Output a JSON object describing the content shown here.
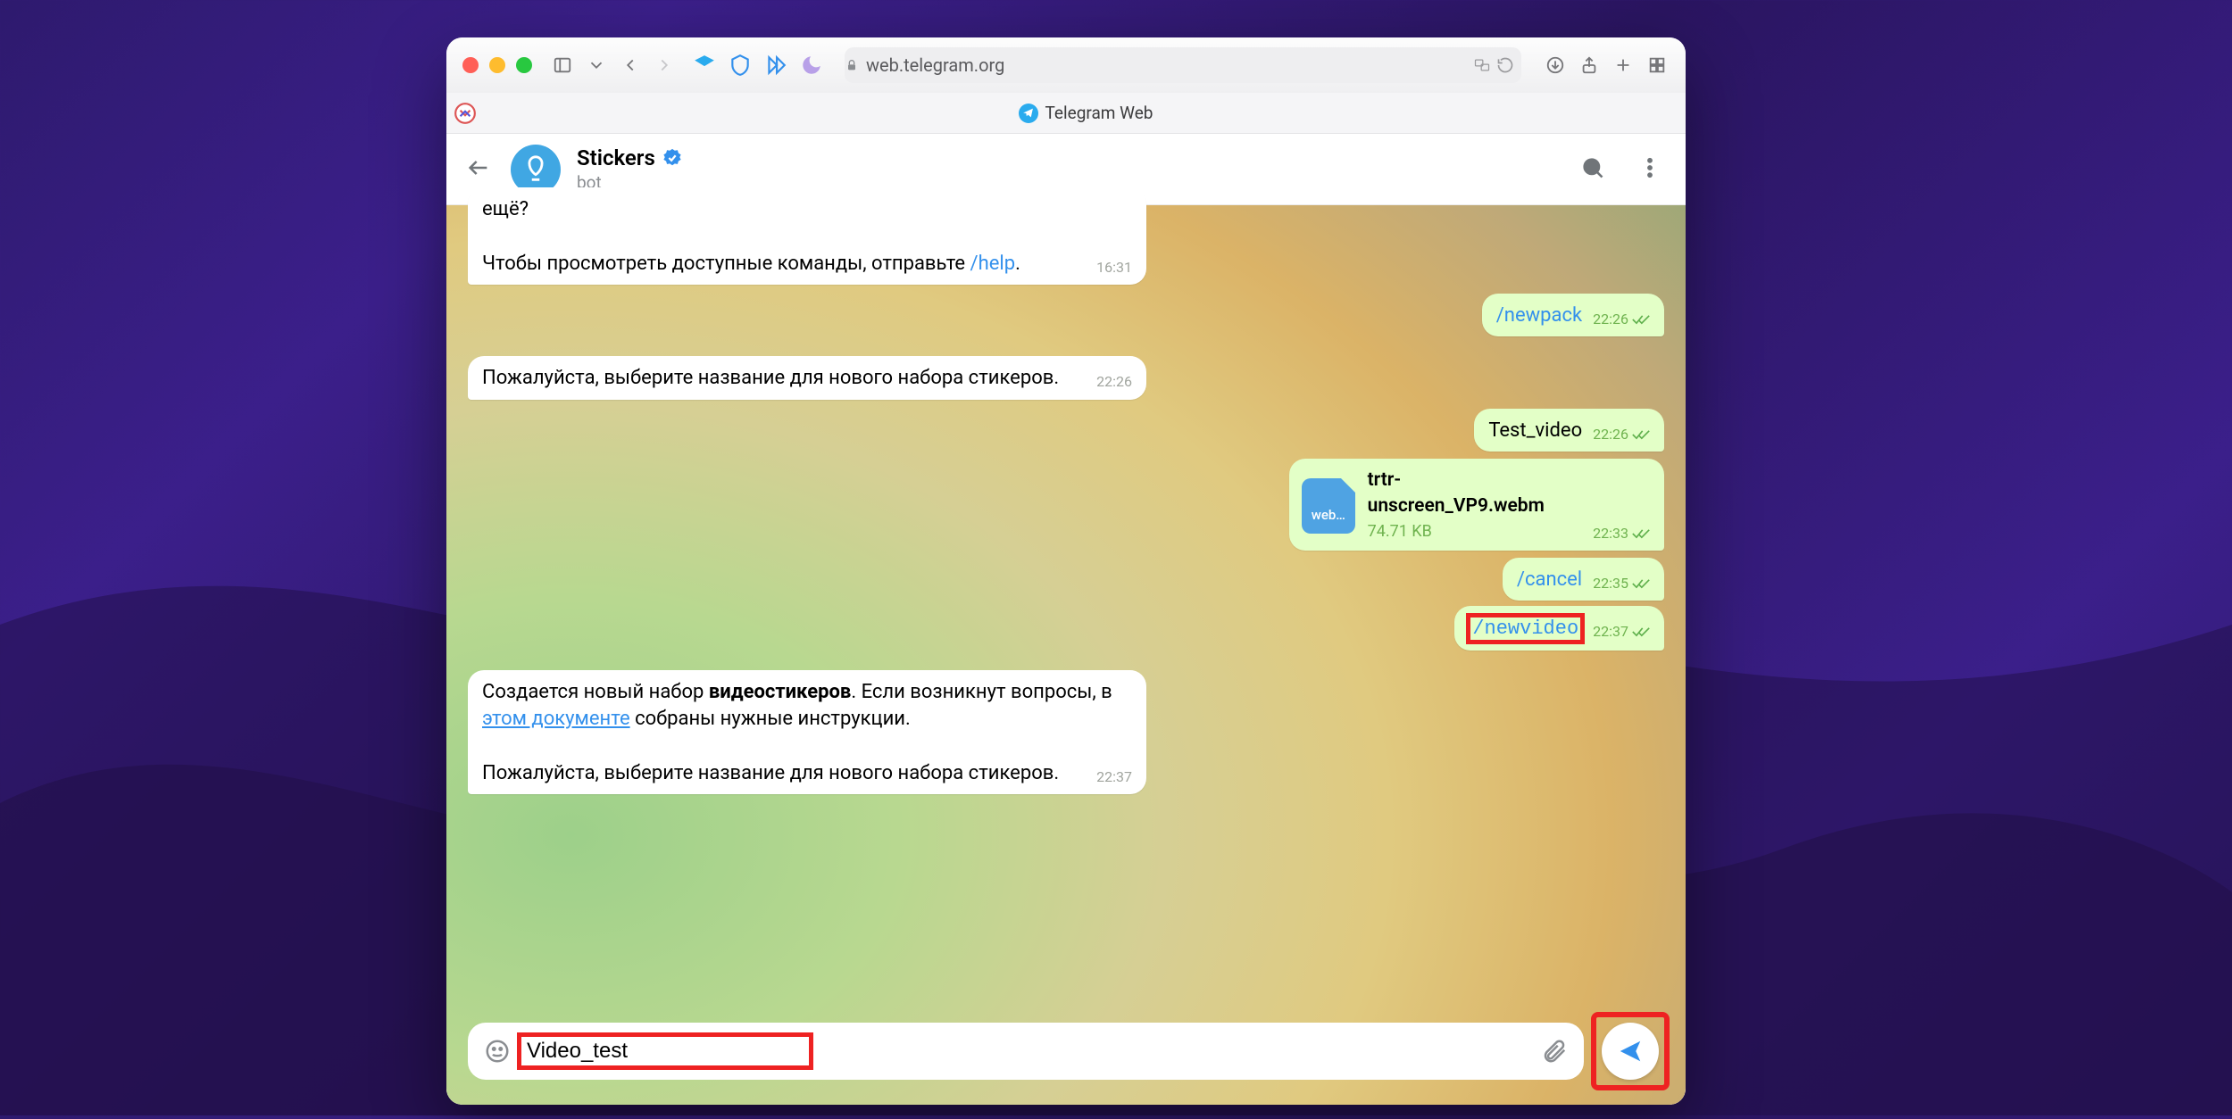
{
  "browser": {
    "url": "web.telegram.org",
    "tab_title": "Telegram Web"
  },
  "chat": {
    "name": "Stickers",
    "subtitle": "bot"
  },
  "messages": {
    "m0_text_part1": "ещё?",
    "m0_text_part2a": "Чтобы просмотреть доступные команды, отправьте ",
    "m0_cmd": "/help",
    "m0_time": "16:31",
    "m1_cmd": "/newpack",
    "m1_time": "22:26",
    "m2_text": "Пожалуйста, выберите название для нового набора стикеров.",
    "m2_time": "22:26",
    "m3_text": "Test_video",
    "m3_time": "22:26",
    "m4_file_ext": "web…",
    "m4_file_name": "trtr-unscreen_VP9.webm",
    "m4_file_size": "74.71 KB",
    "m4_time": "22:33",
    "m5_cmd": "/cancel",
    "m5_time": "22:35",
    "m6_cmd": "/newvideo",
    "m6_time": "22:37",
    "m7_p1a": "Создается новый набор ",
    "m7_p1b": "видеостикеров",
    "m7_p1c": ". Если возникнут вопросы, в ",
    "m7_link": "этом документе",
    "m7_p1d": " собраны нужные инструкции.",
    "m7_p2": "Пожалуйста, выберите название для нового набора стикеров.",
    "m7_time": "22:37"
  },
  "composer": {
    "value": "Video_test"
  }
}
